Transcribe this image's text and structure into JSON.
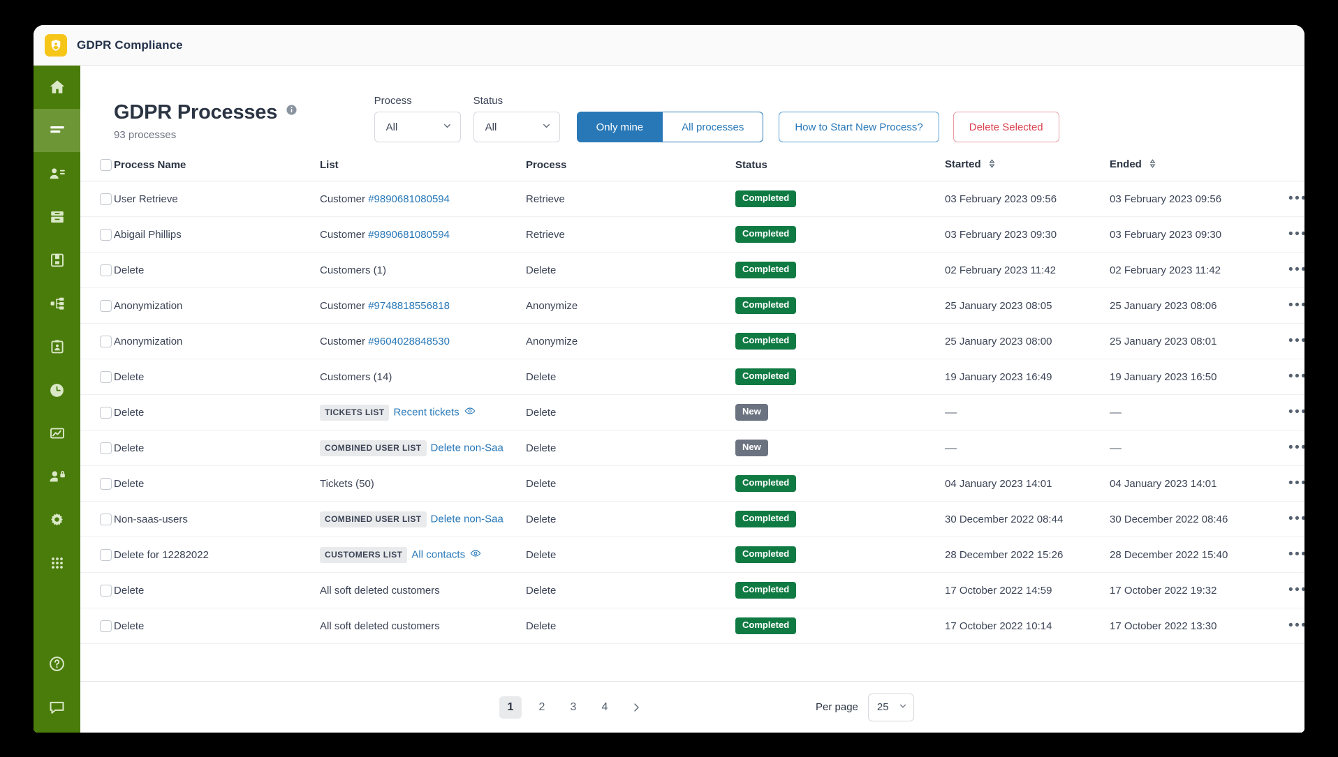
{
  "app": {
    "title": "GDPR Compliance",
    "logo_icon": "shield-user-icon"
  },
  "sidebar": {
    "items": [
      {
        "name": "home",
        "icon": "home-icon",
        "active": false
      },
      {
        "name": "processes",
        "icon": "list-lines-icon",
        "active": true
      },
      {
        "name": "contacts",
        "icon": "user-list-icon",
        "active": false
      },
      {
        "name": "archive",
        "icon": "archive-icon",
        "active": false
      },
      {
        "name": "reports",
        "icon": "save-document-icon",
        "active": false
      },
      {
        "name": "workflows",
        "icon": "flowchart-icon",
        "active": false
      },
      {
        "name": "audits",
        "icon": "clipboard-user-icon",
        "active": false
      },
      {
        "name": "history",
        "icon": "clock-icon",
        "active": false
      },
      {
        "name": "analytics",
        "icon": "chart-image-icon",
        "active": false
      },
      {
        "name": "permissions",
        "icon": "user-lock-icon",
        "active": false
      },
      {
        "name": "settings",
        "icon": "gear-icon",
        "active": false
      },
      {
        "name": "apps",
        "icon": "grid-dots-icon",
        "active": false
      },
      {
        "name": "help",
        "icon": "question-circle-icon",
        "active": false
      },
      {
        "name": "chat",
        "icon": "comment-icon",
        "active": false
      }
    ]
  },
  "page": {
    "title": "GDPR Processes",
    "info_icon": "info-circle-icon",
    "count_text": "93 processes"
  },
  "filters": {
    "process": {
      "label": "Process",
      "value": "All"
    },
    "status": {
      "label": "Status",
      "value": "All"
    },
    "scope_segments": [
      {
        "label": "Only mine",
        "active": true
      },
      {
        "label": "All processes",
        "active": false
      }
    ],
    "how_to_button": "How to Start New Process?",
    "delete_button": "Delete Selected"
  },
  "table": {
    "columns": [
      {
        "key": "name",
        "label": "Process Name",
        "sortable": false
      },
      {
        "key": "list",
        "label": "List",
        "sortable": false
      },
      {
        "key": "process",
        "label": "Process",
        "sortable": false
      },
      {
        "key": "status",
        "label": "Status",
        "sortable": false
      },
      {
        "key": "started",
        "label": "Started",
        "sortable": true
      },
      {
        "key": "ended",
        "label": "Ended",
        "sortable": true
      }
    ],
    "rows": [
      {
        "name": "User Retrieve",
        "list_prefix": "Customer ",
        "list_link": "#9890681080594",
        "list_tag": "",
        "list_eye": false,
        "process": "Retrieve",
        "status": "Completed",
        "status_kind": "completed",
        "started": "03 February 2023 09:56",
        "ended": "03 February 2023 09:56"
      },
      {
        "name": "Abigail Phillips",
        "list_prefix": "Customer ",
        "list_link": "#9890681080594",
        "list_tag": "",
        "list_eye": false,
        "process": "Retrieve",
        "status": "Completed",
        "status_kind": "completed",
        "started": "03 February 2023 09:30",
        "ended": "03 February 2023 09:30"
      },
      {
        "name": "Delete",
        "list_prefix": "Customers  (1)",
        "list_link": "",
        "list_tag": "",
        "list_eye": false,
        "process": "Delete",
        "status": "Completed",
        "status_kind": "completed",
        "started": "02 February 2023 11:42",
        "ended": "02 February 2023 11:42"
      },
      {
        "name": "Anonymization",
        "list_prefix": "Customer ",
        "list_link": "#9748818556818",
        "list_tag": "",
        "list_eye": false,
        "process": "Anonymize",
        "status": "Completed",
        "status_kind": "completed",
        "started": "25 January 2023 08:05",
        "ended": "25 January 2023 08:06"
      },
      {
        "name": "Anonymization",
        "list_prefix": "Customer ",
        "list_link": "#9604028848530",
        "list_tag": "",
        "list_eye": false,
        "process": "Anonymize",
        "status": "Completed",
        "status_kind": "completed",
        "started": "25 January 2023 08:00",
        "ended": "25 January 2023 08:01"
      },
      {
        "name": "Delete",
        "list_prefix": "Customers  (14)",
        "list_link": "",
        "list_tag": "",
        "list_eye": false,
        "process": "Delete",
        "status": "Completed",
        "status_kind": "completed",
        "started": "19 January 2023 16:49",
        "ended": "19 January 2023 16:50"
      },
      {
        "name": "Delete",
        "list_prefix": "",
        "list_link": "Recent tickets",
        "list_tag": "TICKETS LIST",
        "list_eye": true,
        "process": "Delete",
        "status": "New",
        "status_kind": "new",
        "started": "—",
        "ended": "—"
      },
      {
        "name": "Delete",
        "list_prefix": "",
        "list_link": "Delete non-Saa",
        "list_tag": "COMBINED USER LIST",
        "list_eye": false,
        "process": "Delete",
        "status": "New",
        "status_kind": "new",
        "started": "—",
        "ended": "—"
      },
      {
        "name": "Delete",
        "list_prefix": "Tickets (50)",
        "list_link": "",
        "list_tag": "",
        "list_eye": false,
        "process": "Delete",
        "status": "Completed",
        "status_kind": "completed",
        "started": "04 January 2023 14:01",
        "ended": "04 January 2023 14:01"
      },
      {
        "name": "Non-saas-users",
        "list_prefix": "",
        "list_link": "Delete non-Saa",
        "list_tag": "COMBINED USER LIST",
        "list_eye": false,
        "process": "Delete",
        "status": "Completed",
        "status_kind": "completed",
        "started": "30 December 2022 08:44",
        "ended": "30 December 2022 08:46"
      },
      {
        "name": "Delete for 12282022",
        "list_prefix": "",
        "list_link": "All contacts",
        "list_tag": "CUSTOMERS LIST",
        "list_eye": true,
        "process": "Delete",
        "status": "Completed",
        "status_kind": "completed",
        "started": "28 December 2022 15:26",
        "ended": "28 December 2022 15:40"
      },
      {
        "name": "Delete",
        "list_prefix": "All soft deleted customers",
        "list_link": "",
        "list_tag": "",
        "list_eye": false,
        "process": "Delete",
        "status": "Completed",
        "status_kind": "completed",
        "started": "17 October 2022 14:59",
        "ended": "17 October 2022 19:32"
      },
      {
        "name": "Delete",
        "list_prefix": "All soft deleted customers",
        "list_link": "",
        "list_tag": "",
        "list_eye": false,
        "process": "Delete",
        "status": "Completed",
        "status_kind": "completed",
        "started": "17 October 2022 10:14",
        "ended": "17 October 2022 13:30"
      }
    ],
    "row_action_icon": "ellipsis-icon"
  },
  "pagination": {
    "pages": [
      "1",
      "2",
      "3",
      "4"
    ],
    "active_page": "1",
    "next_icon": "chevron-right-icon",
    "per_page_label": "Per page",
    "per_page_value": "25"
  },
  "colors": {
    "sidebar": "#4a7c0b",
    "sidebar_active": "#6d9636",
    "accent_blue": "#2878b8",
    "danger_red": "#d9404e",
    "badge_completed": "#107a43",
    "badge_new": "#6b7280",
    "logo_yellow": "#f5c518"
  }
}
